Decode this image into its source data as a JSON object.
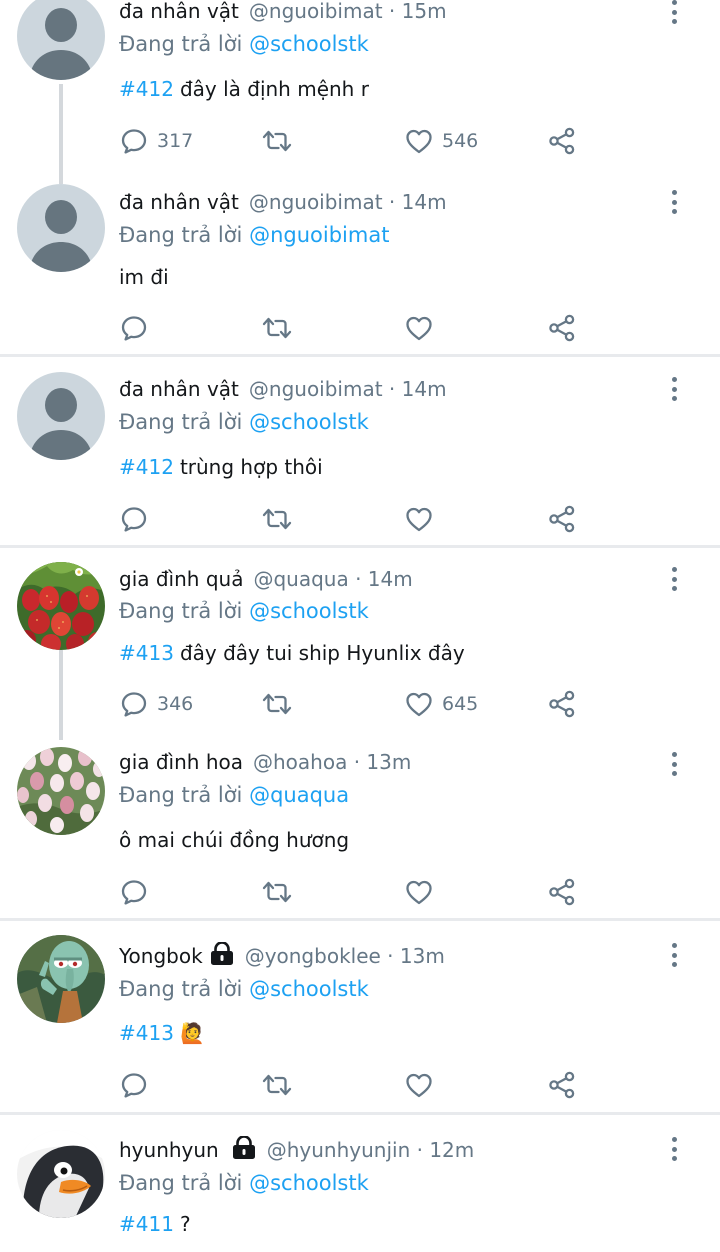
{
  "reply_prefix": "Đang trả lời",
  "tweets": [
    {
      "name": "đa nhân vật",
      "handle": "@nguoibimat",
      "dot": "·",
      "time": "15m",
      "reply_to": "@schoolstk",
      "hashtag": "#412",
      "text": "đây là định mệnh r",
      "reply_count": "317",
      "like_count": "546",
      "avatar": "default-avatar"
    },
    {
      "name": "đa nhân vật",
      "handle": "@nguoibimat",
      "dot": "·",
      "time": "14m",
      "reply_to": "@nguoibimat",
      "hashtag": "",
      "text": "im đi",
      "reply_count": "",
      "like_count": "",
      "avatar": "default-avatar"
    },
    {
      "name": "đa nhân vật",
      "handle": "@nguoibimat",
      "dot": "·",
      "time": "14m",
      "reply_to": "@schoolstk",
      "hashtag": "#412",
      "text": "trùng hợp thôi",
      "reply_count": "",
      "like_count": "",
      "avatar": "default-avatar"
    },
    {
      "name": "gia đình quả",
      "handle": "@quaqua",
      "dot": "·",
      "time": "14m",
      "reply_to": "@schoolstk",
      "hashtag": "#413",
      "text": "đây đây tui ship Hyunlix đây",
      "reply_count": "346",
      "like_count": "645",
      "avatar": "strawberries-avatar"
    },
    {
      "name": "gia đình hoa",
      "handle": "@hoahoa",
      "dot": "·",
      "time": "13m",
      "reply_to": "@quaqua",
      "hashtag": "",
      "text": "ô mai chúi đồng hương",
      "reply_count": "",
      "like_count": "",
      "avatar": "tulips-avatar"
    },
    {
      "name": "Yongbok",
      "handle": "@yongboklee",
      "dot": "·",
      "time": "13m",
      "reply_to": "@schoolstk",
      "hashtag": "#413",
      "text": "🙋",
      "reply_count": "",
      "like_count": "",
      "avatar": "squidward-avatar",
      "locked": true
    },
    {
      "name": "hyunhyun",
      "handle": "@hyunhyunjin",
      "dot": "·",
      "time": "12m",
      "reply_to": "@schoolstk",
      "hashtag": "#411",
      "text": "?",
      "reply_count": "",
      "like_count": "",
      "avatar": "penguin-avatar",
      "locked": true
    }
  ],
  "colors": {
    "link": "#1da1f2",
    "secondary_text": "#657786",
    "primary_text": "#14171a",
    "divider": "#e8eaed",
    "thread_line": "#d4d8dc",
    "avatar_bg": "#ccd6dd",
    "avatar_fg": "#66757f"
  }
}
